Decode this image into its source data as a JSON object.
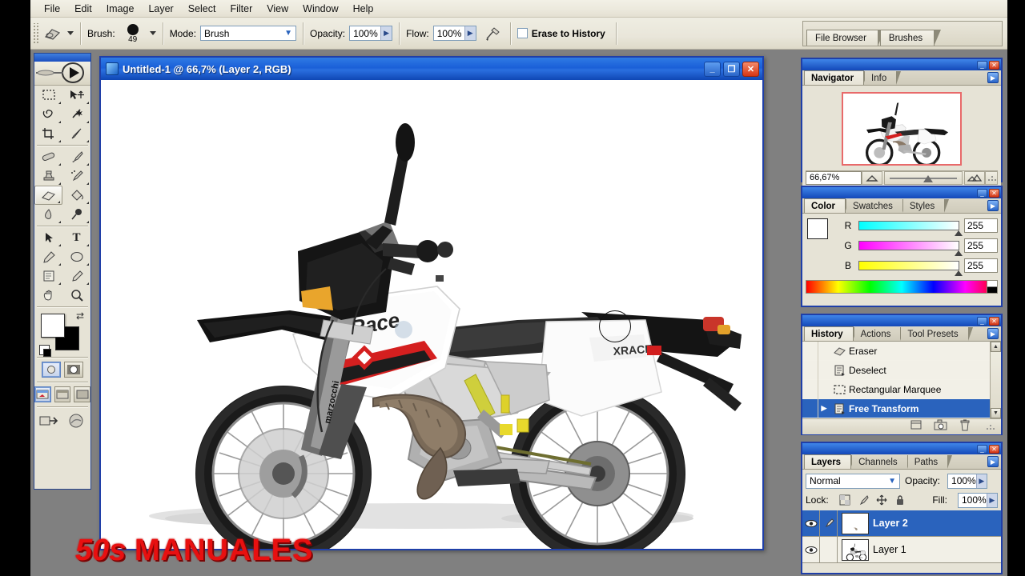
{
  "app": {
    "menu": [
      "File",
      "Edit",
      "Image",
      "Layer",
      "Select",
      "Filter",
      "View",
      "Window",
      "Help"
    ]
  },
  "options_bar": {
    "tool_icon": "eraser-icon",
    "brush_label": "Brush:",
    "brush_size": "49",
    "mode_label": "Mode:",
    "mode_value": "Brush",
    "opacity_label": "Opacity:",
    "opacity_value": "100%",
    "flow_label": "Flow:",
    "flow_value": "100%",
    "airbrush_icon": "airbrush-icon",
    "erase_to_history_label": "Erase to History",
    "erase_to_history_checked": false,
    "palette_well_icon": "palettes-icon"
  },
  "palette_well": {
    "tabs": [
      "File Browser",
      "Brushes"
    ]
  },
  "toolbox": {
    "tools": [
      {
        "name": "marquee-tool",
        "glyph": "▭"
      },
      {
        "name": "move-tool",
        "glyph": "✥"
      },
      {
        "name": "lasso-tool",
        "glyph": "✂"
      },
      {
        "name": "magic-wand-tool",
        "glyph": "✳"
      },
      {
        "name": "crop-tool",
        "glyph": "⌗"
      },
      {
        "name": "slice-tool",
        "glyph": "✎"
      },
      {
        "name": "healing-brush-tool",
        "glyph": "✐"
      },
      {
        "name": "brush-tool",
        "glyph": "🖌"
      },
      {
        "name": "clone-stamp-tool",
        "glyph": "⌚"
      },
      {
        "name": "history-brush-tool",
        "glyph": "✧"
      },
      {
        "name": "eraser-tool",
        "glyph": "◰"
      },
      {
        "name": "gradient-tool",
        "glyph": "◧"
      },
      {
        "name": "blur-tool",
        "glyph": "💧"
      },
      {
        "name": "dodge-tool",
        "glyph": "🔍"
      },
      {
        "name": "path-selection-tool",
        "glyph": "➤"
      },
      {
        "name": "type-tool",
        "glyph": "T"
      },
      {
        "name": "pen-tool",
        "glyph": "✒"
      },
      {
        "name": "shape-tool",
        "glyph": "⬭"
      },
      {
        "name": "notes-tool",
        "glyph": "▤"
      },
      {
        "name": "eyedropper-tool",
        "glyph": "⚲"
      },
      {
        "name": "hand-tool",
        "glyph": "✋"
      },
      {
        "name": "zoom-tool",
        "glyph": "🔎"
      }
    ],
    "selected_tool": "eraser-tool",
    "foreground_color": "#ffffff",
    "background_color": "#000000"
  },
  "document": {
    "title": "Untitled-1 @ 66,7% (Layer 2, RGB)",
    "minimize_label": "_",
    "maximize_label": "❐",
    "close_label": "✕",
    "canvas_image": "motorcycle-xrace-white-supermoto"
  },
  "navigator": {
    "tabs": [
      "Navigator",
      "Info"
    ],
    "active_tab": "Navigator",
    "zoom_value": "66,67%",
    "thumbnail": "motorcycle-thumbnail",
    "view_box_color": "#e86a6a"
  },
  "color_palette": {
    "tabs": [
      "Color",
      "Swatches",
      "Styles"
    ],
    "active_tab": "Color",
    "channels": [
      {
        "label": "R",
        "value": "255"
      },
      {
        "label": "G",
        "value": "255"
      },
      {
        "label": "B",
        "value": "255"
      }
    ],
    "foreground": "#ffffff",
    "background": "#000000"
  },
  "history_palette": {
    "tabs": [
      "History",
      "Actions",
      "Tool Presets"
    ],
    "active_tab": "History",
    "items": [
      {
        "label": "Eraser",
        "icon": "eraser-icon",
        "selected": false
      },
      {
        "label": "Deselect",
        "icon": "document-icon",
        "selected": false
      },
      {
        "label": "Rectangular Marquee",
        "icon": "marquee-icon",
        "selected": false
      },
      {
        "label": "Free Transform",
        "icon": "document-icon",
        "selected": true
      }
    ],
    "footer_buttons": [
      "new-document-icon",
      "new-snapshot-icon",
      "trash-icon"
    ]
  },
  "layers_palette": {
    "tabs": [
      "Layers",
      "Channels",
      "Paths"
    ],
    "active_tab": "Layers",
    "blend_mode": "Normal",
    "opacity_label": "Opacity:",
    "opacity_value": "100%",
    "lock_label": "Lock:",
    "fill_label": "Fill:",
    "fill_value": "100%",
    "lock_icons": [
      "lock-transparency-icon",
      "lock-image-icon",
      "lock-position-icon",
      "lock-all-icon"
    ],
    "layers": [
      {
        "name": "Layer 2",
        "visible": true,
        "selected": true,
        "thumb": "transparent-checker",
        "has_brush_icon": true
      },
      {
        "name": "Layer 1",
        "visible": true,
        "selected": false,
        "thumb": "motorcycle-thumbnail",
        "has_brush_icon": false
      }
    ]
  },
  "watermark": {
    "part1": "50s",
    "part2": "MANUALES",
    "color": "#e81010"
  }
}
